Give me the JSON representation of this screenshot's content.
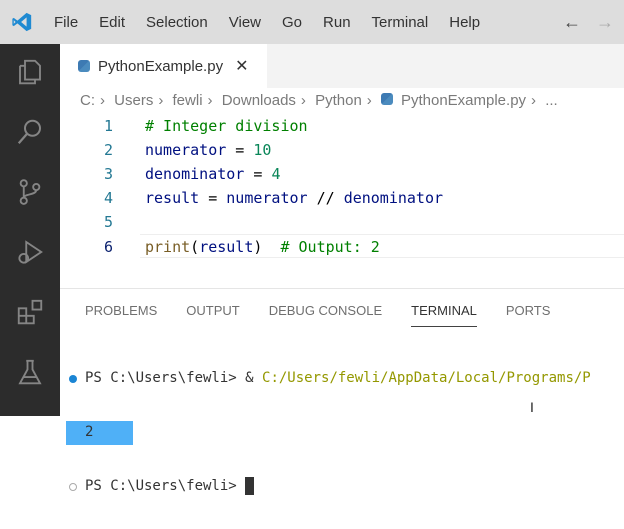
{
  "menu": [
    "File",
    "Edit",
    "Selection",
    "View",
    "Go",
    "Run",
    "Terminal",
    "Help"
  ],
  "nav": {
    "back": "←",
    "forward": "→"
  },
  "tab": {
    "label": "PythonExample.py",
    "close": "✕"
  },
  "breadcrumbs": [
    "C:",
    "Users",
    "fewli",
    "Downloads",
    "Python",
    "PythonExample.py",
    "..."
  ],
  "code": {
    "lines": [
      "1",
      "2",
      "3",
      "4",
      "5",
      "6"
    ],
    "l1": "# Integer division",
    "l2a": "numerator",
    "l2b": " = ",
    "l2c": "10",
    "l3a": "denominator",
    "l3b": " = ",
    "l3c": "4",
    "l4a": "result",
    "l4b": " = ",
    "l4c": "numerator",
    "l4d": " // ",
    "l4e": "denominator",
    "l6a": "print",
    "l6b": "(",
    "l6c": "result",
    "l6d": ")  ",
    "l6e": "# Output: 2"
  },
  "panel": {
    "tabs": [
      "PROBLEMS",
      "OUTPUT",
      "DEBUG CONSOLE",
      "TERMINAL",
      "PORTS"
    ]
  },
  "terminal": {
    "prompt": "PS C:\\Users\\fewli> ",
    "amp": "& ",
    "cmd": "C:/Users/fewli/AppData/Local/Programs/P",
    "output": "2"
  },
  "colors": {
    "accent": "#007acc",
    "selection": "#4fb0f7"
  }
}
